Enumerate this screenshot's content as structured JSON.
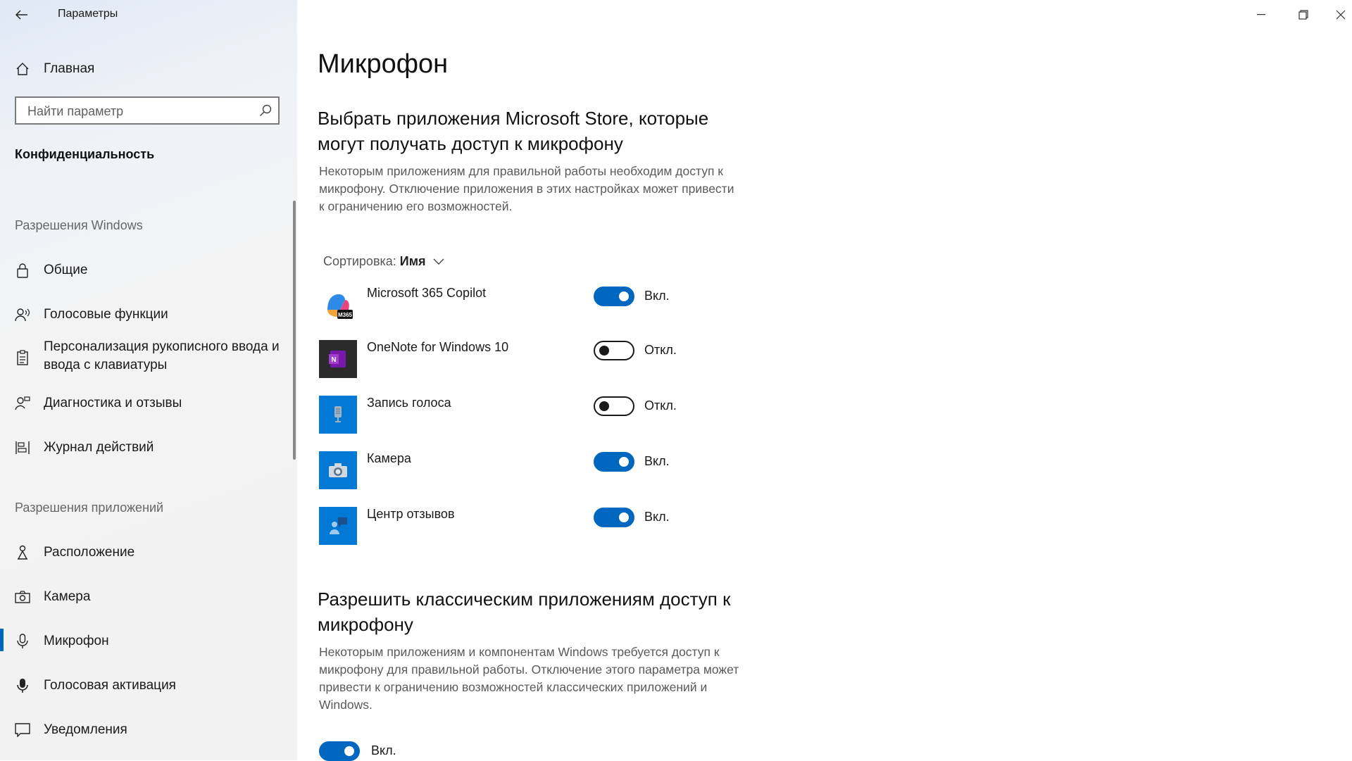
{
  "window": {
    "title": "Параметры",
    "controls": [
      "minimize-icon",
      "restore-icon",
      "close-icon"
    ]
  },
  "sidebar": {
    "home_label": "Главная",
    "search_placeholder": "Найти параметр",
    "category": "Конфиденциальность",
    "windows_permissions_header": "Разрешения Windows",
    "windows_permissions": [
      {
        "label": "Общие",
        "icon": "lock-icon"
      },
      {
        "label": "Голосовые функции",
        "icon": "speech-icon"
      },
      {
        "label": "Персонализация рукописного ввода и ввода с клавиатуры",
        "icon": "clipboard-icon"
      },
      {
        "label": "Диагностика и отзывы",
        "icon": "feedback-icon"
      },
      {
        "label": "Журнал действий",
        "icon": "timeline-icon"
      }
    ],
    "app_permissions_header": "Разрешения приложений",
    "app_permissions": [
      {
        "label": "Расположение",
        "icon": "location-icon"
      },
      {
        "label": "Камера",
        "icon": "camera-icon"
      },
      {
        "label": "Микрофон",
        "icon": "microphone-icon",
        "active": true
      },
      {
        "label": "Голосовая активация",
        "icon": "voice-activation-icon"
      },
      {
        "label": "Уведомления",
        "icon": "notification-icon"
      }
    ]
  },
  "main": {
    "page_title": "Микрофон",
    "store_heading": "Выбрать приложения Microsoft Store, которые могут получать доступ к микрофону",
    "store_desc": "Некоторым приложениям для правильной работы необходим доступ к микрофону. Отключение приложения в этих настройках может привести к ограничению его возможностей.",
    "sort_label": "Сортировка:",
    "sort_value": "Имя",
    "apps": [
      {
        "name": "Microsoft 365 Copilot",
        "state": "Вкл.",
        "on": true,
        "icon": "copilot-icon"
      },
      {
        "name": "OneNote for Windows 10",
        "state": "Откл.",
        "on": false,
        "icon": "onenote-icon"
      },
      {
        "name": "Запись голоса",
        "state": "Откл.",
        "on": false,
        "icon": "voice-recorder-icon"
      },
      {
        "name": "Камера",
        "state": "Вкл.",
        "on": true,
        "icon": "camera-app-icon"
      },
      {
        "name": "Центр отзывов",
        "state": "Вкл.",
        "on": true,
        "icon": "feedback-hub-icon"
      }
    ],
    "desktop_heading": "Разрешить классическим приложениям доступ к микрофону",
    "desktop_desc": "Некоторым приложениям и компонентам Windows требуется доступ к микрофону для правильной работы. Отключение этого параметра может привести к ограничению возможностей классических приложений и Windows.",
    "desktop_toggle_state": "Вкл.",
    "desktop_toggle_on": true
  },
  "colors": {
    "accent": "#0067c0",
    "sidebar_bg": "#f2f2f2",
    "secondary_text": "#5a5a5a"
  }
}
